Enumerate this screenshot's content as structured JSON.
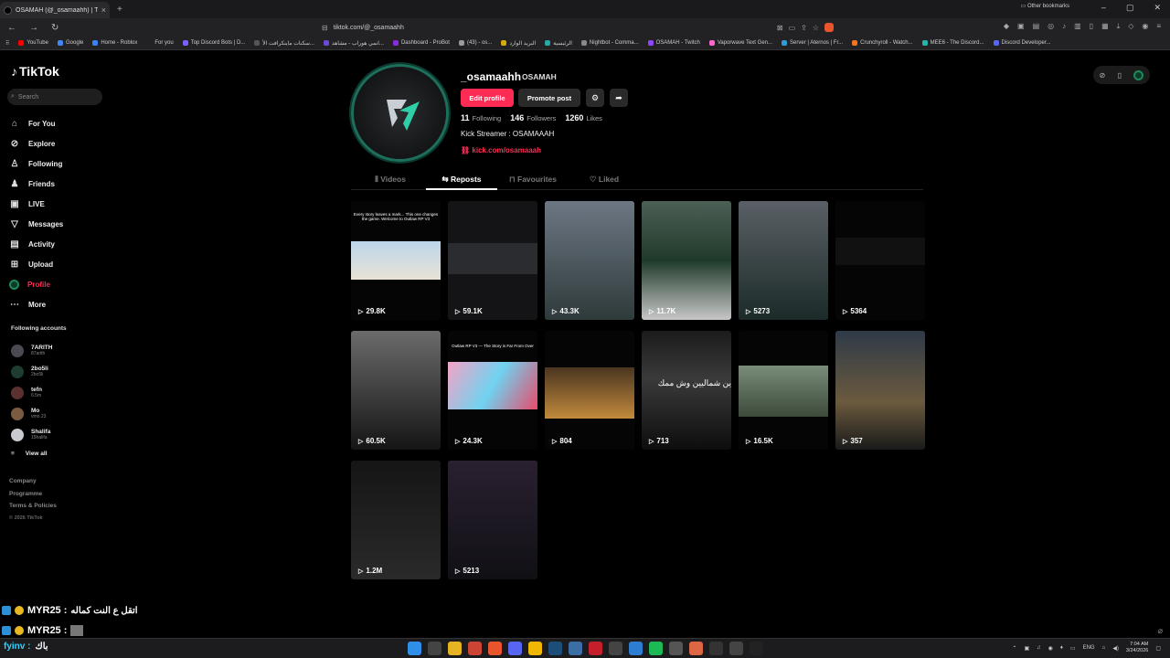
{
  "browser": {
    "tab_title": "OSAMAH (@_osamaahh) | TikTok",
    "url": "tiktok.com/@_osamaahh",
    "bookmarks": [
      "YouTube",
      "Google",
      "Home - Roblox",
      "For you",
      "Top Discord Bots | D...",
      "سكنات ماينكرافت الأ...",
      "انمي هوراب - مشاهد...",
      "Dashboard - ProBot",
      "(43) - os...",
      "البريد الوارد",
      "الرئيسية",
      "Nightbot - Comma...",
      "OSAMAH - Twitch",
      "Vaporwave Text Gen...",
      "Server | Aternos | Fr...",
      "Crunchyroll - Watch...",
      "MEE6 - The Discord...",
      "Discord Developer..."
    ],
    "other_bookmarks": "Other bookmarks"
  },
  "sidebar": {
    "logo": "TikTok",
    "search_placeholder": "Search",
    "menu": [
      {
        "label": "For You",
        "icon": "home-icon",
        "glyph": "⌂"
      },
      {
        "label": "Explore",
        "icon": "compass-icon",
        "glyph": "⊘"
      },
      {
        "label": "Following",
        "icon": "following-icon",
        "glyph": "♙"
      },
      {
        "label": "Friends",
        "icon": "friends-icon",
        "glyph": "♟"
      },
      {
        "label": "LIVE",
        "icon": "live-icon",
        "glyph": "▣"
      },
      {
        "label": "Messages",
        "icon": "messages-icon",
        "glyph": "▽"
      },
      {
        "label": "Activity",
        "icon": "activity-icon",
        "glyph": "▤"
      },
      {
        "label": "Upload",
        "icon": "upload-icon",
        "glyph": "⊞"
      },
      {
        "label": "Profile",
        "icon": "profile-icon",
        "glyph": ""
      },
      {
        "label": "More",
        "icon": "more-icon",
        "glyph": "⋯"
      }
    ],
    "following_title": "Following accounts",
    "accounts": [
      {
        "name": "7ARITH",
        "handle": "87arith"
      },
      {
        "name": "2bo5li",
        "handle": "2bo5li"
      },
      {
        "name": "tefn",
        "handle": "6.5m"
      },
      {
        "name": "Mo",
        "handle": "vmo.23"
      },
      {
        "name": "Shalifa",
        "handle": "15halifa"
      }
    ],
    "view_all": "View all",
    "footer": [
      "Company",
      "Programme",
      "Terms & Policies"
    ],
    "copyright": "© 2026 TikTok"
  },
  "profile": {
    "username": "_osamaahh",
    "display_name": "OSAMAH",
    "edit_label": "Edit profile",
    "promote_label": "Promote post",
    "following_count": "11",
    "following_label": "Following",
    "followers_count": "146",
    "followers_label": "Followers",
    "likes_count": "1260",
    "likes_label": "Likes",
    "bio": "Kick Streamer : OSAMAAAH",
    "link": "kick.com/osamaaah",
    "accent": "#fe2c55"
  },
  "tabs": [
    {
      "label": "Videos",
      "icon": "grid-icon",
      "glyph": "⦀"
    },
    {
      "label": "Reposts",
      "icon": "repost-icon",
      "glyph": "⇆"
    },
    {
      "label": "Favourites",
      "icon": "bookmark-icon",
      "glyph": "⊓"
    },
    {
      "label": "Liked",
      "icon": "heart-icon",
      "glyph": "♡"
    }
  ],
  "videos": [
    {
      "views": "29.8K",
      "caption": "Every story leaves a mark... This one changes the game. Welcome to Outlaw RP V3"
    },
    {
      "views": "59.1K",
      "caption": ""
    },
    {
      "views": "43.3K",
      "caption": ""
    },
    {
      "views": "11.7K",
      "caption": ""
    },
    {
      "views": "5273",
      "caption": ""
    },
    {
      "views": "5364",
      "caption": ""
    },
    {
      "views": "60.5K",
      "caption": ""
    },
    {
      "views": "24.3K",
      "caption": "Outlaw RP V3 — The Story is Far From Over"
    },
    {
      "views": "804",
      "caption": ""
    },
    {
      "views": "713",
      "caption": "ين شماليين وش ممك"
    },
    {
      "views": "16.5K",
      "caption": ""
    },
    {
      "views": "357",
      "caption": ""
    },
    {
      "views": "1.2M",
      "caption": ""
    },
    {
      "views": "5213",
      "caption": ""
    }
  ],
  "overlay_chat": [
    {
      "nick": "MYR25 :",
      "message": "اتقل ع النت كماله"
    },
    {
      "nick": "MYR25 :",
      "message": ""
    }
  ],
  "taskbar": {
    "chat_nick": "fyinv :",
    "chat_msg": "باك",
    "lang": "ENG",
    "time": "7:04 AM",
    "date": "3/24/2026"
  }
}
